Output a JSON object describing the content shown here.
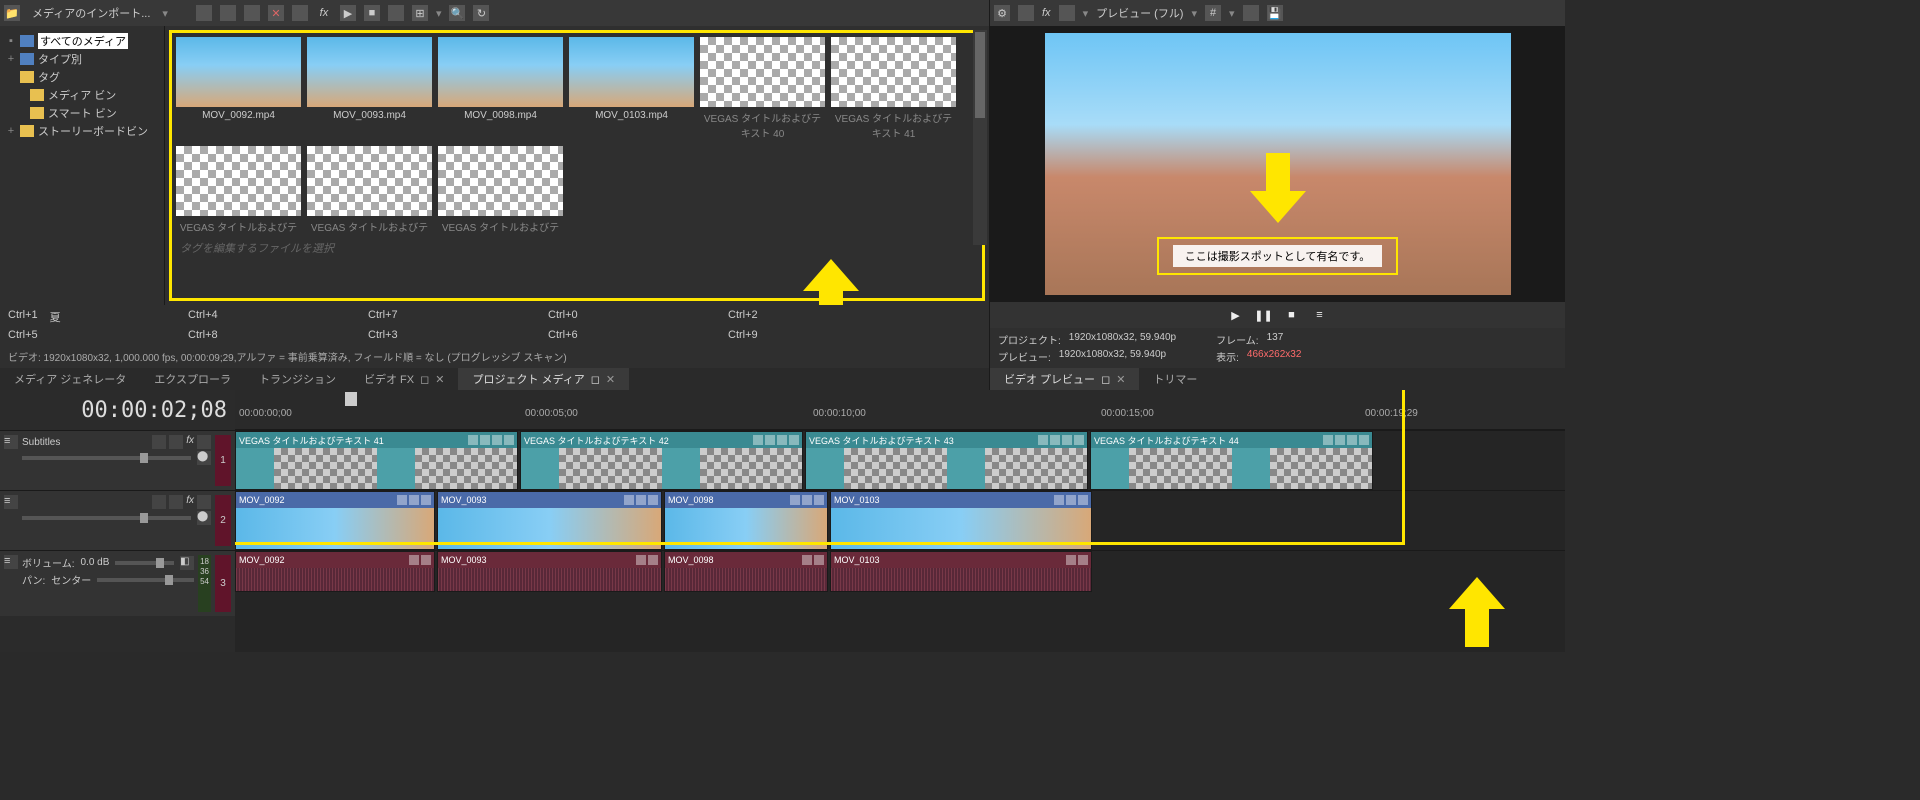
{
  "media_panel": {
    "import_label": "メディアのインポート...",
    "tree": {
      "all_media": "すべてのメディア",
      "by_type": "タイプ別",
      "tags": "タグ",
      "media_bin": "メディア ビン",
      "smart_bin": "スマート ビン",
      "storyboard_bin": "ストーリーボードビン"
    },
    "items": [
      {
        "name": "MOV_0092.mp4",
        "kind": "video"
      },
      {
        "name": "MOV_0093.mp4",
        "kind": "video"
      },
      {
        "name": "MOV_0098.mp4",
        "kind": "video"
      },
      {
        "name": "MOV_0103.mp4",
        "kind": "video"
      },
      {
        "name": "VEGAS タイトルおよびテキスト 40",
        "kind": "gen"
      },
      {
        "name": "VEGAS タイトルおよびテキスト 41",
        "kind": "gen"
      },
      {
        "name": "VEGAS タイトルおよびテ",
        "kind": "gen"
      },
      {
        "name": "VEGAS タイトルおよびテ",
        "kind": "gen"
      },
      {
        "name": "VEGAS タイトルおよびテ",
        "kind": "gen"
      }
    ],
    "tag_placeholder": "タグを編集するファイルを選択",
    "shortcuts": [
      {
        "k": "Ctrl+1",
        "v": "夏"
      },
      {
        "k": "Ctrl+4",
        "v": ""
      },
      {
        "k": "Ctrl+7",
        "v": ""
      },
      {
        "k": "Ctrl+0",
        "v": ""
      },
      {
        "k": "Ctrl+2",
        "v": ""
      },
      {
        "k": "Ctrl+5",
        "v": ""
      },
      {
        "k": "Ctrl+8",
        "v": ""
      },
      {
        "k": "Ctrl+3",
        "v": ""
      },
      {
        "k": "Ctrl+6",
        "v": ""
      },
      {
        "k": "Ctrl+9",
        "v": ""
      }
    ],
    "status": "ビデオ: 1920x1080x32, 1,000.000 fps, 00:00:09;29,アルファ = 事前乗算済み, フィールド順 = なし (プログレッシブ スキャン)",
    "tabs": {
      "generators": "メディア ジェネレータ",
      "explorer": "エクスプローラ",
      "transition": "トランジション",
      "video_fx": "ビデオ FX",
      "project_media": "プロジェクト メディア"
    }
  },
  "preview": {
    "title": "プレビュー (フル)",
    "caption": "ここは撮影スポットとして有名です。",
    "info": {
      "project_label": "プロジェクト:",
      "project_val": "1920x1080x32, 59.940p",
      "preview_label": "プレビュー:",
      "preview_val": "1920x1080x32, 59.940p",
      "frame_label": "フレーム:",
      "frame_val": "137",
      "display_label": "表示:",
      "display_val": "466x262x32"
    },
    "tabs": {
      "video_preview": "ビデオ プレビュー",
      "trimmer": "トリマー"
    }
  },
  "timeline": {
    "timecode": "00:00:02;08",
    "ruler": [
      "00:00:00;00",
      "00:00:05;00",
      "00:00:10;00",
      "00:00:15;00",
      "00:00:19;29"
    ],
    "tracks": {
      "subtitle": "Subtitles",
      "vol_label": "ボリューム:",
      "vol_val": "0.0 dB",
      "pan_label": "パン:",
      "pan_val": "センター",
      "levels": [
        "18",
        "36",
        "54"
      ]
    },
    "title_clips": [
      "VEGAS タイトルおよびテキスト 41",
      "VEGAS タイトルおよびテキスト 42",
      "VEGAS タイトルおよびテキスト 43",
      "VEGAS タイトルおよびテキスト 44"
    ],
    "video_clips": [
      "MOV_0092",
      "MOV_0093",
      "MOV_0098",
      "MOV_0103"
    ],
    "audio_clips": [
      "MOV_0092",
      "MOV_0093",
      "MOV_0098",
      "MOV_0103"
    ]
  }
}
